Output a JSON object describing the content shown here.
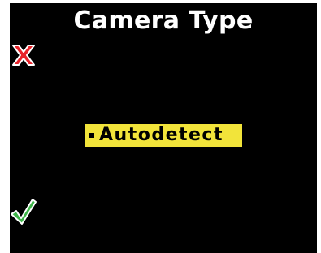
{
  "screen": {
    "title": "Camera Type",
    "background_color": "#000000"
  },
  "controls": {
    "cancel_icon": "cross-icon",
    "cancel_color": "#e8232a",
    "confirm_icon": "checkmark-icon",
    "confirm_color": "#3fb64a"
  },
  "options": [
    {
      "label": "Autodetect",
      "selected": true,
      "highlight_color": "#f2e43a"
    }
  ]
}
